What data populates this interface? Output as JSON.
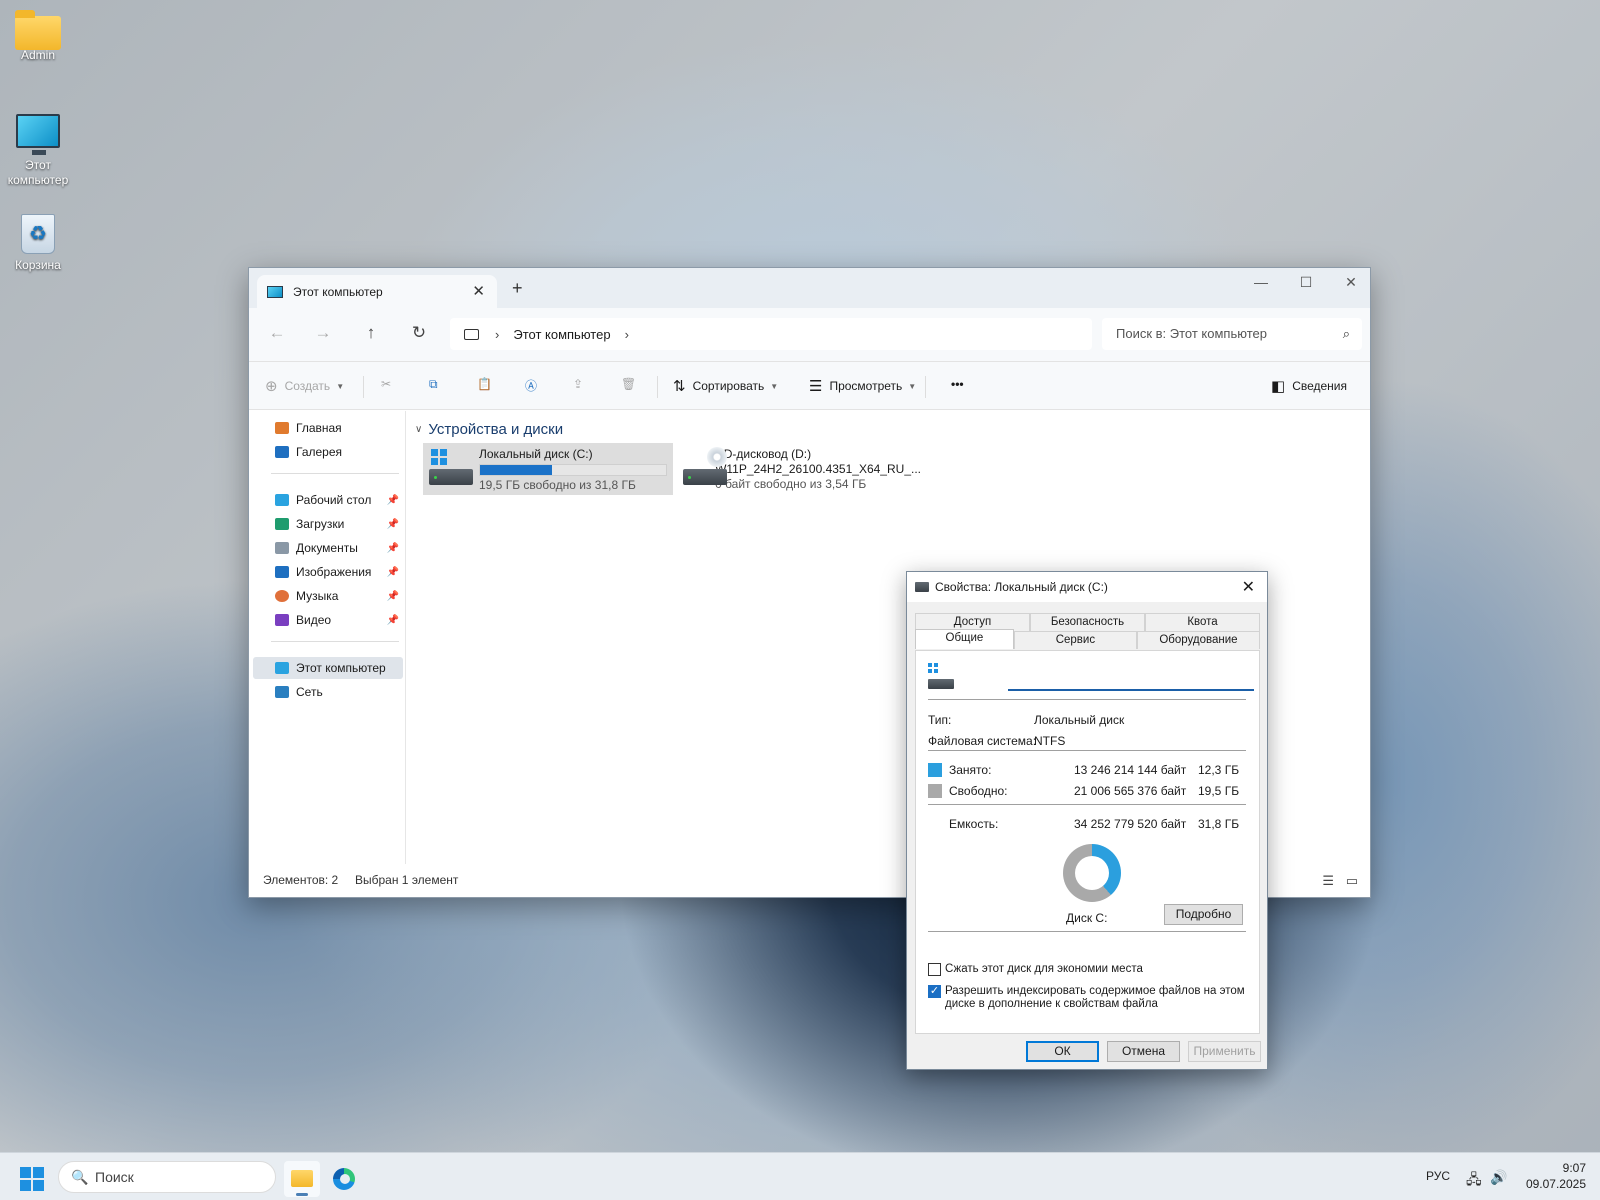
{
  "desktop": {
    "icons": [
      {
        "label": "Admin",
        "icon": "folder-icon"
      },
      {
        "label": "Этот компьютер",
        "icon": "computer-icon"
      },
      {
        "label": "Корзина",
        "icon": "recycle-bin-icon"
      }
    ]
  },
  "explorer": {
    "tab_title": "Этот компьютер",
    "new_tab": "+",
    "window_controls": {
      "minimize": "—",
      "maximize": "☐",
      "close": "✕"
    },
    "nav": {
      "back": "←",
      "forward": "→",
      "up": "↑",
      "refresh": "↻"
    },
    "breadcrumb": [
      "Этот компьютер"
    ],
    "search_placeholder": "Поиск в: Этот компьютер",
    "toolbar": {
      "create": "Создать",
      "sort": "Сортировать",
      "view": "Просмотреть",
      "more": "•••",
      "details": "Сведения"
    },
    "sidebar": {
      "items": [
        {
          "label": "Главная",
          "icon": "home-icon",
          "color": "#e07a2e"
        },
        {
          "label": "Галерея",
          "icon": "gallery-icon",
          "color": "#1f6fc0"
        },
        {
          "label": "Рабочий стол",
          "icon": "desktop-icon",
          "color": "#2aa3e0",
          "pinned": true
        },
        {
          "label": "Загрузки",
          "icon": "downloads-icon",
          "color": "#1f9c6e",
          "pinned": true
        },
        {
          "label": "Документы",
          "icon": "documents-icon",
          "color": "#8a98a6",
          "pinned": true
        },
        {
          "label": "Изображения",
          "icon": "pictures-icon",
          "color": "#1e6fc0",
          "pinned": true
        },
        {
          "label": "Музыка",
          "icon": "music-icon",
          "color": "#e0703a",
          "pinned": true
        },
        {
          "label": "Видео",
          "icon": "videos-icon",
          "color": "#7a3fc0",
          "pinned": true
        },
        {
          "label": "Этот компьютер",
          "icon": "computer-icon",
          "color": "#2aa3e0"
        },
        {
          "label": "Сеть",
          "icon": "network-icon",
          "color": "#2a7fc0"
        }
      ]
    },
    "section_title": "Устройства и диски",
    "drives": [
      {
        "name": "Локальный диск (C:)",
        "free_text": "19,5 ГБ свободно из 31,8 ГБ",
        "used_fraction": 0.387
      },
      {
        "name": "CD-дисковод (D:)",
        "label": "W11P_24H2_26100.4351_X64_RU_...",
        "free_text": "0 байт свободно из 3,54 ГБ"
      }
    ],
    "status": {
      "count": "Элементов: 2",
      "selected": "Выбран 1 элемент"
    }
  },
  "dialog": {
    "title": "Свойства: Локальный диск (C:)",
    "tabs_row1": [
      "Доступ",
      "Безопасность",
      "Квота"
    ],
    "tabs_row2": [
      "Общие",
      "Сервис",
      "Оборудование"
    ],
    "name_value": "",
    "type_label": "Тип:",
    "type_value": "Локальный диск",
    "fs_label": "Файловая система:",
    "fs_value": "NTFS",
    "used_label": "Занято:",
    "used_bytes": "13 246 214 144 байт",
    "used_gb": "12,3 ГБ",
    "free_label": "Свободно:",
    "free_bytes": "21 006 565 376 байт",
    "free_gb": "19,5 ГБ",
    "capacity_label": "Емкость:",
    "capacity_bytes": "34 252 779 520 байт",
    "capacity_gb": "31,8 ГБ",
    "used_fraction": 0.387,
    "colors": {
      "used": "#2b9fde",
      "free": "#a9a9a9"
    },
    "disk_label": "Диск C:",
    "details_button": "Подробно",
    "compress_label": "Сжать этот диск для экономии места",
    "compress_checked": false,
    "index_label_line1": "Разрешить индексировать содержимое файлов на этом",
    "index_label_line2": "диске в дополнение к свойствам файла",
    "index_checked": true,
    "ok": "ОК",
    "cancel": "Отмена",
    "apply": "Применить"
  },
  "taskbar": {
    "search_placeholder": "Поиск",
    "language": "РУС",
    "time": "9:07",
    "date": "09.07.2025"
  }
}
